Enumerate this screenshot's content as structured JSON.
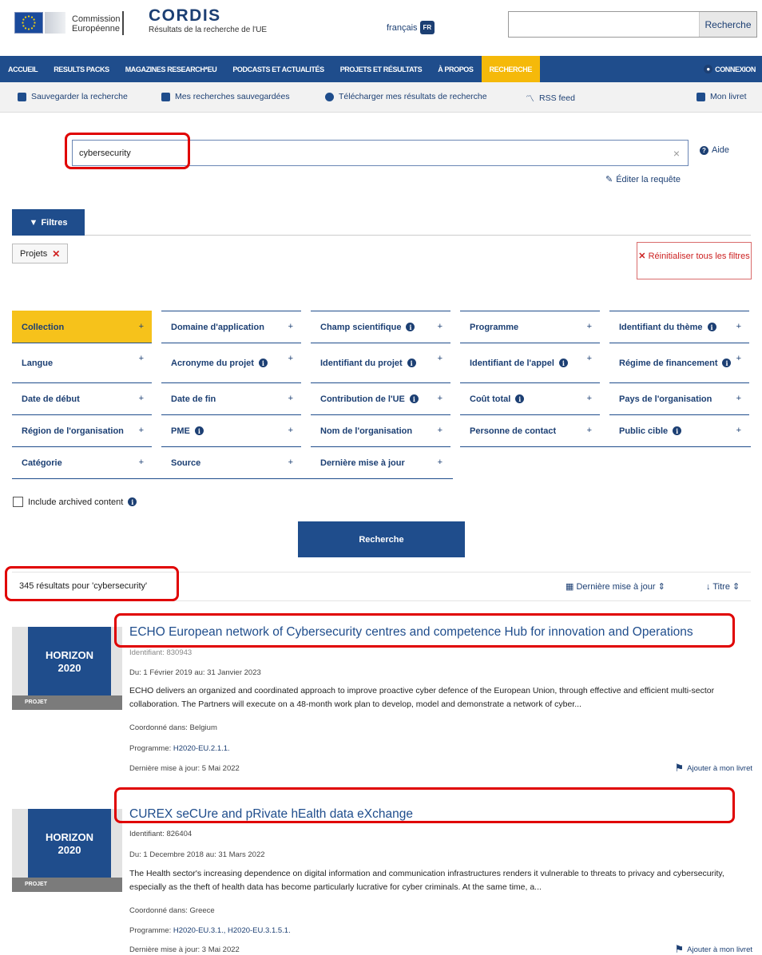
{
  "header": {
    "commission_line1": "Commission",
    "commission_line2": "Européenne",
    "logo": "CORDIS",
    "subtitle": "Résultats de la recherche de l'UE",
    "language": "français",
    "language_code": "FR",
    "search_button": "Recherche"
  },
  "nav": {
    "items": [
      "ACCUEIL",
      "RESULTS PACKS",
      "MAGAZINES RESEARCH*EU",
      "PODCASTS ET ACTUALITÉS",
      "PROJETS ET RÉSULTATS",
      "À PROPOS",
      "RECHERCHE"
    ],
    "login": "CONNEXION"
  },
  "toolbar": {
    "save_search": "Sauvegarder la recherche",
    "saved_searches": "Mes recherches sauvegardées",
    "download": "Télécharger mes résultats de recherche",
    "rss": "RSS feed",
    "booklet": "Mon livret"
  },
  "search": {
    "query": "cybersecurity",
    "help": "Aide",
    "edit_query": "Éditer la requête"
  },
  "filters": {
    "tab_label": "Filtres",
    "active_chip": "Projets",
    "reset_label": "Réinitialiser tous les filtres",
    "facets": [
      "Collection",
      "Domaine d'application",
      "Champ scientifique",
      "Programme",
      "Identifiant du thème",
      "Langue",
      "Acronyme du projet",
      "Identifiant du projet",
      "Identifiant de l'appel",
      "Régime de financement",
      "Date de début",
      "Date de fin",
      "Contribution de l'UE",
      "Coût total",
      "Pays de l'organisation",
      "Région de l'organisation",
      "PME",
      "Nom de l'organisation",
      "Personne de contact",
      "Public cible",
      "Catégorie",
      "Source",
      "Dernière mise à jour"
    ],
    "archived_label": "Include archived content",
    "search_button": "Recherche"
  },
  "results": {
    "count_text": "345 résultats pour 'cybersecurity'",
    "sort_date": "Dernière mise à jour",
    "sort_title": "Titre",
    "items": [
      {
        "thumb_line1": "HORIZON",
        "thumb_line2": "2020",
        "thumb_tag": "PROJET",
        "title": "ECHO European network of Cybersecurity centres and competence Hub for innovation and Operations",
        "identifier": "Identifiant: 830943",
        "dates": "Du: 1 Février 2019 au: 31 Janvier 2023",
        "description": "ECHO delivers an organized and coordinated approach to improve proactive cyber defence of the European Union, through effective and efficient multi-sector collaboration. The Partners will execute on a 48-month work plan to develop, model and demonstrate a network of cyber...",
        "coordinated_label": "Coordonné dans:",
        "coordinated": "Belgium",
        "programme_label": "Programme:",
        "programme": "H2020-EU.2.1.1.",
        "updated": "Dernière mise à jour: 5 Mai 2022",
        "add": "Ajouter à mon livret"
      },
      {
        "thumb_line1": "HORIZON",
        "thumb_line2": "2020",
        "thumb_tag": "PROJET",
        "title": "CUREX seCUre and pRivate hEalth data eXchange",
        "identifier": "Identifiant: 826404",
        "dates": "Du: 1 Decembre 2018 au: 31 Mars 2022",
        "description": "The Health sector's increasing dependence on digital information and communication infrastructures renders it vulnerable to threats to privacy and cybersecurity, especially as the theft of health data has become particularly lucrative for cyber criminals. At the same time, a...",
        "coordinated_label": "Coordonné dans:",
        "coordinated": "Greece",
        "programme_label": "Programme:",
        "programme": "H2020-EU.3.1., H2020-EU.3.1.5.1.",
        "updated": "Dernière mise à jour: 3 Mai 2022",
        "add": "Ajouter à mon livret"
      }
    ]
  }
}
